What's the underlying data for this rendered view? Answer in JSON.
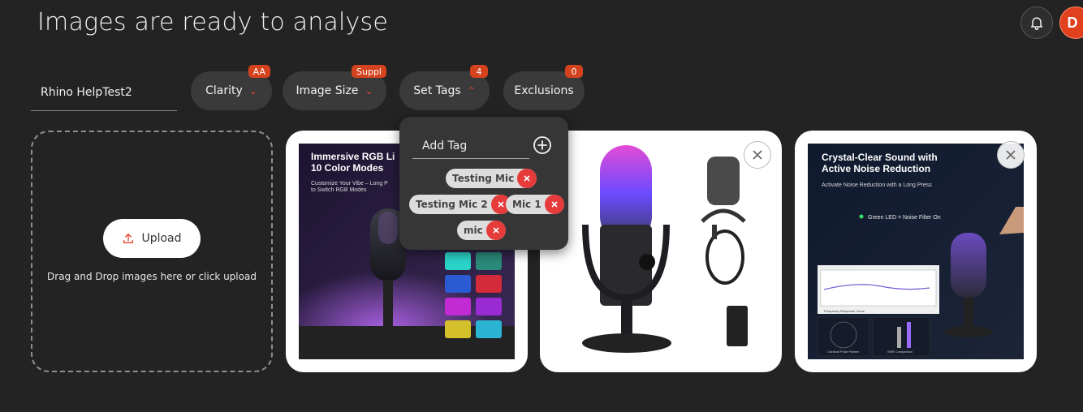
{
  "header": {
    "title": "Images are ready to analyse",
    "avatar_initial": "D"
  },
  "project": {
    "name": "Rhino HelpTest2"
  },
  "filters": [
    {
      "label": "Clarity",
      "badge": "AA"
    },
    {
      "label": "Image Size",
      "badge": "Suppl"
    },
    {
      "label": "Set Tags",
      "badge": "4"
    },
    {
      "label": "Exclusions",
      "badge": "0"
    }
  ],
  "tags_popup": {
    "placeholder": "Add Tag",
    "tags": [
      "Testing Mic",
      "Testing Mic 2",
      "Mic 1",
      "mic"
    ]
  },
  "upload": {
    "button_label": "Upload",
    "hint": "Drag and Drop images here or click upload"
  },
  "images": [
    {
      "headline": "Immersive RGB Li\n10 Color Modes",
      "sub": "Customize Your Vibe – Long P\nto Switch RGB Modes"
    },
    {
      "headline": "",
      "sub": ""
    },
    {
      "headline": "Crystal-Clear Sound with\nActive Noise Reduction",
      "sub": "Activate Noise Reduction with a Long Press",
      "led_note": "Green LED = Noise Filter On",
      "chart_caption_1": "Frequency Response Curve",
      "chart_caption_2": "Cardioid Polar Pattern",
      "chart_caption_3": "SNR Comparison"
    }
  ],
  "colors": {
    "accent": "#e8452a",
    "badge": "#d4421e",
    "remove_red": "#e63b3b"
  }
}
